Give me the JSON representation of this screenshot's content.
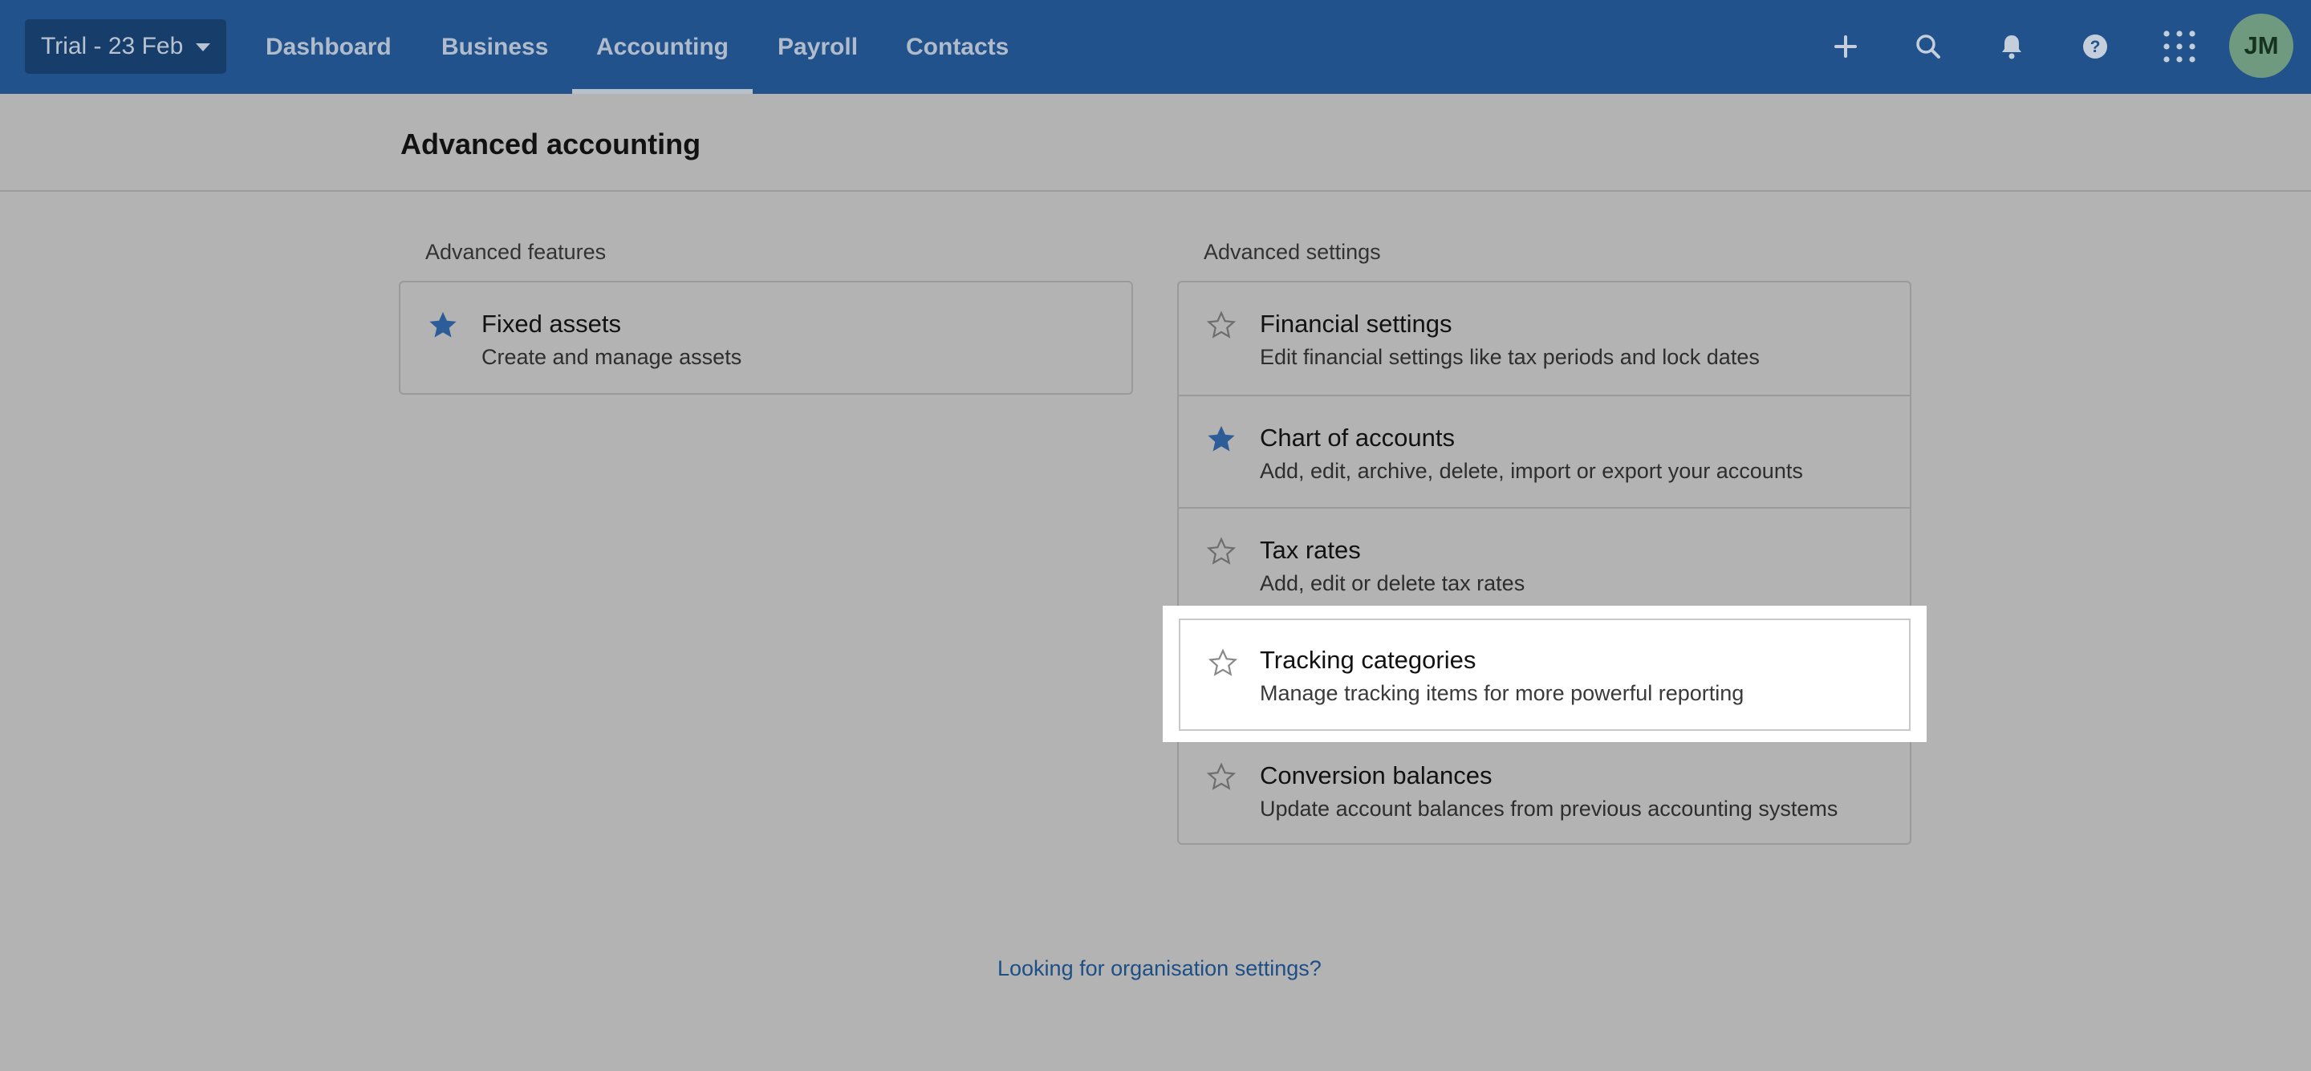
{
  "topbar": {
    "org_label": "Trial - 23 Feb",
    "nav": [
      {
        "label": "Dashboard"
      },
      {
        "label": "Business"
      },
      {
        "label": "Accounting",
        "active": true
      },
      {
        "label": "Payroll"
      },
      {
        "label": "Contacts"
      }
    ],
    "icons": [
      "plus-icon",
      "search-icon",
      "bell-icon",
      "help-icon",
      "app-grid-icon"
    ],
    "avatar_initials": "JM"
  },
  "page": {
    "title": "Advanced accounting"
  },
  "features": {
    "label": "Advanced features",
    "items": [
      {
        "title": "Fixed assets",
        "desc": "Create and manage assets",
        "starred": true
      }
    ]
  },
  "settings": {
    "label": "Advanced settings",
    "items": [
      {
        "title": "Financial settings",
        "desc": "Edit financial settings like tax periods and lock dates",
        "starred": false
      },
      {
        "title": "Chart of accounts",
        "desc": "Add, edit, archive, delete, import or export your accounts",
        "starred": true
      },
      {
        "title": "Tax rates",
        "desc": "Add, edit or delete tax rates",
        "starred": false
      },
      {
        "title": "Tracking categories",
        "desc": "Manage tracking items for more powerful reporting",
        "starred": false,
        "highlighted": true
      },
      {
        "title": "Conversion balances",
        "desc": "Update account balances from previous accounting systems",
        "starred": false
      }
    ]
  },
  "footer": {
    "link_text": "Looking for organisation settings?"
  },
  "colors": {
    "nav_bg": "#22528c",
    "star_filled": "#2c5d99",
    "link": "#1d4f86"
  }
}
